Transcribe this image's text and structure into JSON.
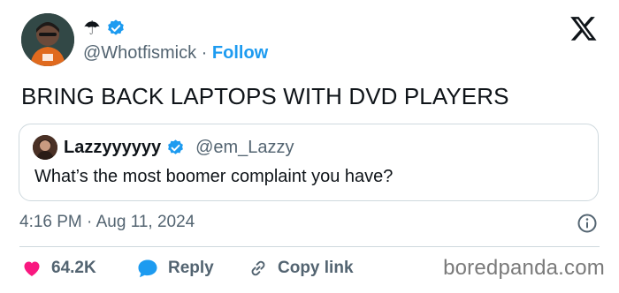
{
  "author": {
    "display_name_emoji": "☂",
    "handle": "@Whotfismick",
    "separator": "·",
    "follow_label": "Follow",
    "verified": true
  },
  "tweet": {
    "text": "BRING BACK LAPTOPS WITH DVD PLAYERS",
    "time": "4:16 PM",
    "date_separator": "·",
    "date": "Aug 11, 2024"
  },
  "quoted": {
    "name": "Lazzyyyyyy",
    "handle": "@em_Lazzy",
    "text": "What’s the most boomer complaint you have?",
    "verified": true
  },
  "actions": {
    "likes": "64.2K",
    "reply_label": "Reply",
    "copy_label": "Copy link"
  },
  "watermark": "boredpanda.com",
  "colors": {
    "accent": "#1d9bf0",
    "like": "#f91880",
    "muted": "#536471",
    "border": "#cfd9de"
  },
  "icons": {
    "platform": "x-logo-icon",
    "verified": "verified-badge-icon",
    "like": "heart-icon",
    "reply": "reply-bubble-icon",
    "copy": "link-icon",
    "info": "info-icon"
  }
}
